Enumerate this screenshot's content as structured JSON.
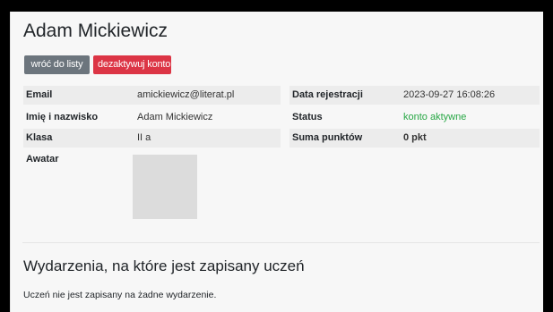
{
  "student": {
    "name": "Adam Mickiewicz"
  },
  "actions": {
    "back_label": "wróć do listy",
    "deactivate_label": "dezaktywuj konto"
  },
  "details_left": [
    {
      "label": "Email",
      "value": "amickiewicz@literat.pl"
    },
    {
      "label": "Imię i nazwisko",
      "value": "Adam Mickiewicz"
    },
    {
      "label": "Klasa",
      "value": "II a"
    },
    {
      "label": "Awatar",
      "value": ""
    }
  ],
  "details_right": [
    {
      "label": "Data rejestracji",
      "value": "2023-09-27 16:08:26"
    },
    {
      "label": "Status",
      "value": "konto aktywne"
    },
    {
      "label": "Suma punktów",
      "value": "0 pkt"
    }
  ],
  "colors": {
    "status_active": "#28a745",
    "danger": "#dc3545",
    "secondary": "#6c757d"
  },
  "events": {
    "title": "Wydarzenia, na które jest zapisany uczeń",
    "empty_message": "Uczeń nie jest zapisany na żadne wydarzenie."
  }
}
